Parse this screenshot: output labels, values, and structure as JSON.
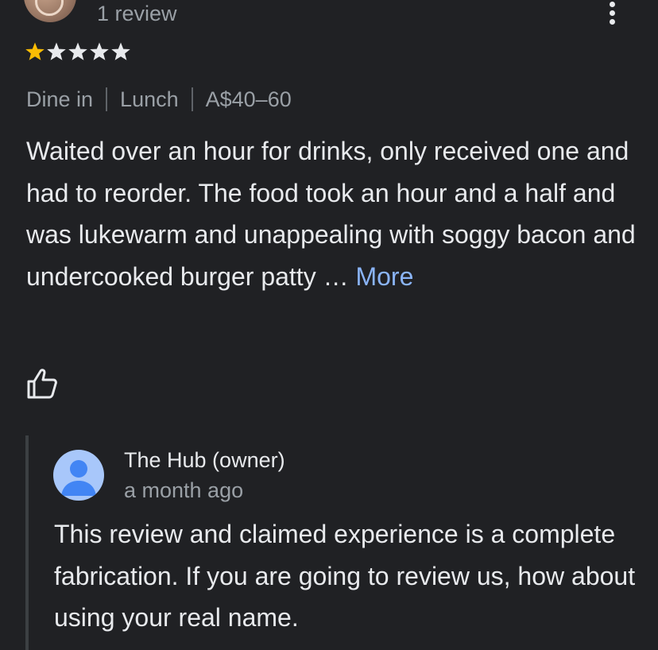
{
  "review": {
    "count_label": "1 review",
    "rating": 1,
    "rating_max": 5,
    "meta": [
      "Dine in",
      "Lunch",
      "A$40–60"
    ],
    "text": "Waited over an hour for drinks, only received one and had to reorder. The food took an hour and a half and was lukewarm and unappealing with soggy bacon and undercooked burger patty ",
    "ellipsis": "…",
    "more_label": "More"
  },
  "reply": {
    "owner_name": "The Hub (owner)",
    "time": "a month ago",
    "text": "This review and claimed experience is a complete fabrication. If you are going to review us, how about using your real name."
  },
  "colors": {
    "background": "#202124",
    "star_filled": "#fbbc04",
    "star_empty": "#e8eaed",
    "link": "#8ab4f8",
    "owner_avatar": "#a8c7fa",
    "owner_avatar_glyph": "#4285f4"
  },
  "icons": {
    "menu": "more-vert-icon",
    "like": "thumb-up-icon",
    "avatar": "account-circle-icon",
    "star": "star-icon"
  }
}
